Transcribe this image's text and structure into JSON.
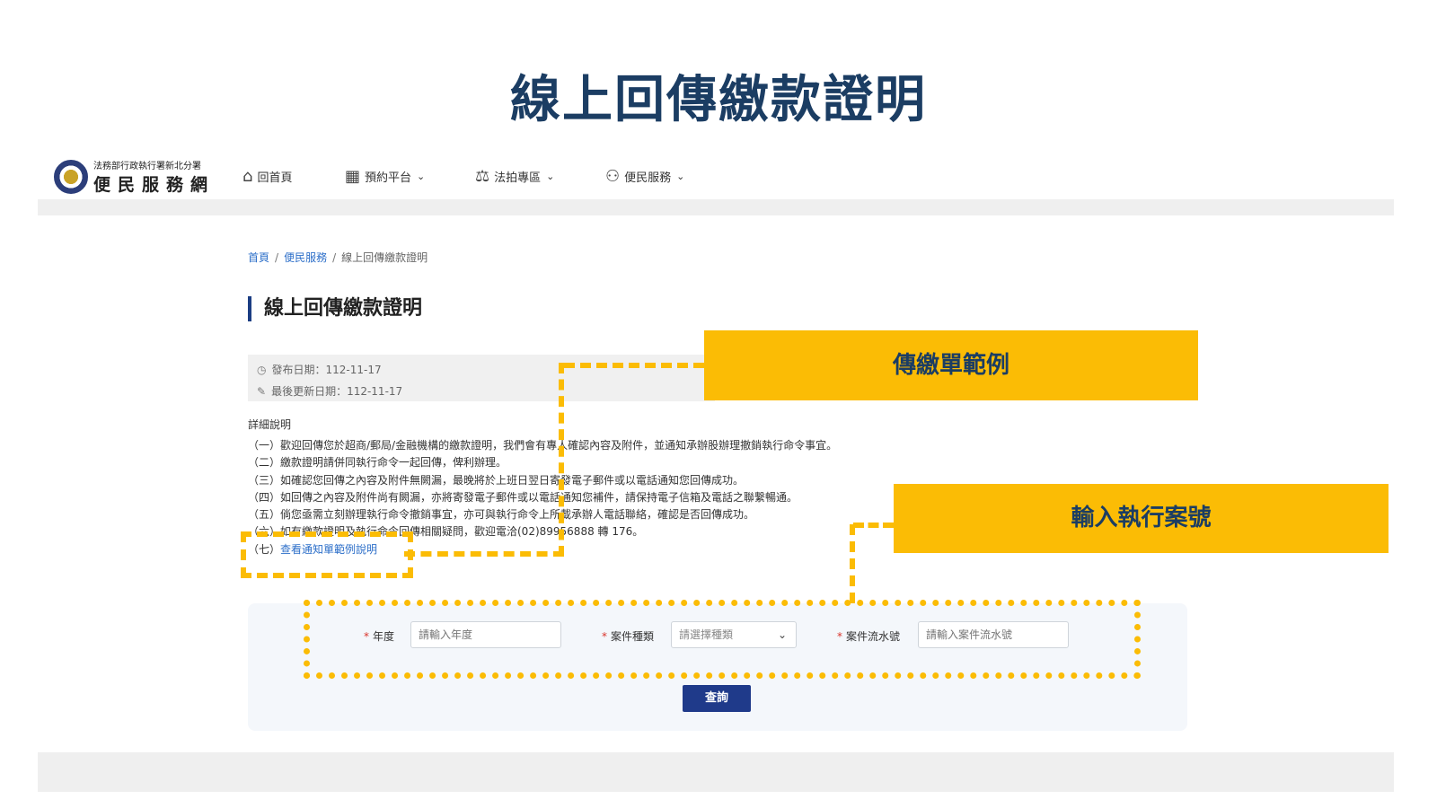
{
  "slide_title": "線上回傳繳款證明",
  "logo": {
    "agency": "法務部行政執行署新北分署",
    "site_name": "便民服務網"
  },
  "nav": [
    {
      "icon": "home-icon",
      "label": "回首頁",
      "has_dropdown": false
    },
    {
      "icon": "calendar-icon",
      "label": "預約平台",
      "has_dropdown": true
    },
    {
      "icon": "gavel-icon",
      "label": "法拍專區",
      "has_dropdown": true
    },
    {
      "icon": "people-icon",
      "label": "便民服務",
      "has_dropdown": true
    }
  ],
  "breadcrumb": {
    "home": "首頁",
    "section": "便民服務",
    "current": "線上回傳繳款證明",
    "separator": "/"
  },
  "page_title": "線上回傳繳款證明",
  "meta": {
    "published": "發布日期：112-11-17",
    "updated": "最後更新日期：112-11-17"
  },
  "detail_label": "詳細說明",
  "details": [
    "（一）歡迎回傳您於超商/郵局/金融機構的繳款證明，我們會有專人確認內容及附件，並通知承辦股辦理撤銷執行命令事宜。",
    "（二）繳款證明請併同執行命令一起回傳，俾利辦理。",
    "（三）如確認您回傳之內容及附件無闕漏，最晚將於上班日翌日寄發電子郵件或以電話通知您回傳成功。",
    "（四）如回傳之內容及附件尚有闕漏，亦將寄發電子郵件或以電話通知您補件，請保持電子信箱及電話之聯繫暢通。",
    "（五）倘您亟需立刻辦理執行命令撤銷事宜，亦可與執行命令上所載承辦人電話聯絡，確認是否回傳成功。",
    "（六）如有繳款證明及執行命令回傳相關疑問，歡迎電洽(02)89956888 轉 176。"
  ],
  "detail_link": {
    "prefix": "（七）",
    "text": "查看通知單範例說明"
  },
  "form": {
    "year_label": "年度",
    "year_placeholder": "請輸入年度",
    "type_label": "案件種類",
    "type_selected": "請選擇種類",
    "serial_label": "案件流水號",
    "serial_placeholder": "請輸入案件流水號",
    "required_mark": "*",
    "submit_label": "查詢"
  },
  "annotations": {
    "callout_1": "傳繳單範例",
    "callout_2": "輸入執行案號",
    "color": "#fbbc05"
  },
  "colors": {
    "title": "#1b3d63",
    "primary_button": "#1f3a8a",
    "link": "#2d6fc9",
    "required": "#d9342b"
  }
}
